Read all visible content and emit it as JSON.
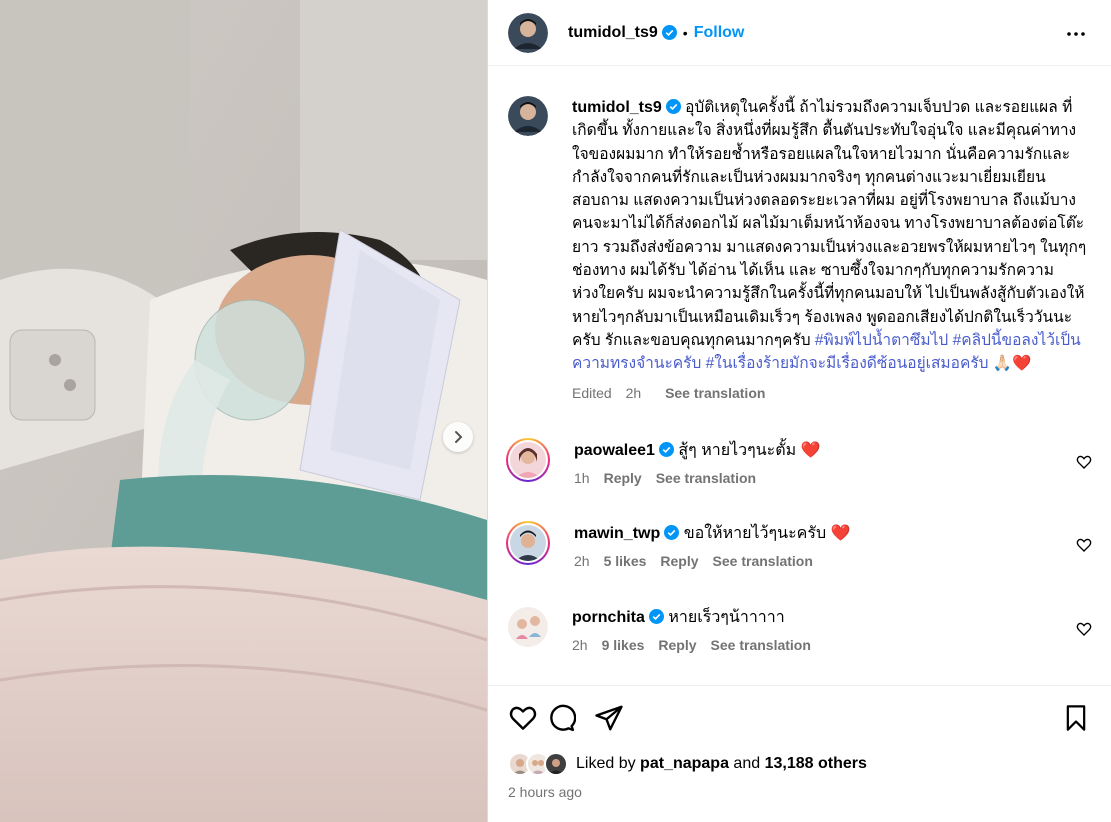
{
  "post": {
    "author": "tumidol_ts9",
    "separator": "•",
    "follow_label": "Follow",
    "caption": "อุบัติเหตุในครั้งนี้ ถ้าไม่รวมถึงความเจ็บปวด และรอยแผล ที่เกิดขึ้น ทั้งกายและใจ สิ่งหนึ่งที่ผมรู้สึก ตื้นตันประทับใจอุ่นใจ และมีคุณค่าทางใจของผมมาก ทำให้รอยช้ำหรือรอยแผลในใจหายไวมาก นั่นคือความรักและกำลังใจจากคนที่รักและเป็นห่วงผมมากจริงๆ ทุกคนต่างแวะมาเยี่ยมเยียนสอบถาม แสดงความเป็นห่วงตลอดระยะเวลาที่ผม อยู่ที่โรงพยาบาล ถึงแม้บางคนจะมาไม่ได้ก็ส่งดอกไม้ ผลไม้มาเต็มหน้าห้องจน ทางโรงพยาบาลต้องต่อโต๊ะยาว รวมถึงส่งข้อความ มาแสดงความเป็นห่วงและอวยพรให้ผมหายไวๆ ในทุกๆช่องทาง ผมได้รับ ได้อ่าน ได้เห็น และ ซาบซึ้งใจมากๆกับทุกความรักความห่วงใยครับ ผมจะนำความรู้สึกในครั้งนี้ที่ทุกคนมอบให้ ไปเป็นพลังสู้กับตัวเองให้หายไวๆกลับมาเป็นเหมือนเดิมเร็วๆ ร้องเพลง พูดออกเสียงได้ปกติในเร็ววันนะครับ รักและขอบคุณทุกคนมากๆครับ",
    "hashtags": [
      "#พิมพ์ไปน้ำตาซึมไป",
      "#คลิปนี้ขอลงไว้เป็นความทรงจำนะครับ",
      "#ในเรื่องร้ายมักจะมีเรื่องดีซ้อนอยู่เสมอครับ"
    ],
    "caption_emoji": "🙏🏻❤️",
    "edited_label": "Edited",
    "caption_time": "2h",
    "see_translation": "See translation"
  },
  "comments": [
    {
      "user": "paowalee1",
      "verified": true,
      "text": "สู้ๆ หายไวๆนะตั้ม",
      "emoji": "❤️",
      "time": "1h",
      "likes": "",
      "reply": "Reply",
      "translate": "See translation"
    },
    {
      "user": "mawin_twp",
      "verified": true,
      "text": "ขอให้หายไว้ๆนะครับ",
      "emoji": "❤️",
      "time": "2h",
      "likes": "5 likes",
      "reply": "Reply",
      "translate": "See translation"
    },
    {
      "user": "pornchita",
      "verified": true,
      "text": "หายเร็วๆน้าาาาา",
      "emoji": "",
      "time": "2h",
      "likes": "9 likes",
      "reply": "Reply",
      "translate": "See translation"
    }
  ],
  "likes": {
    "prefix": "Liked by",
    "user": "pat_napapa",
    "mid": "and",
    "count": "13,188 others"
  },
  "posted": "2 hours ago",
  "colors": {
    "accent": "#0095f6",
    "verified": "#0095f6",
    "heart": "#ff3040",
    "hashtag": "#4a5ccc",
    "muted": "#737373"
  },
  "icons": [
    "verified-icon",
    "more-icon",
    "chevron-right-icon",
    "heart-icon",
    "comment-icon",
    "share-icon",
    "bookmark-icon"
  ]
}
